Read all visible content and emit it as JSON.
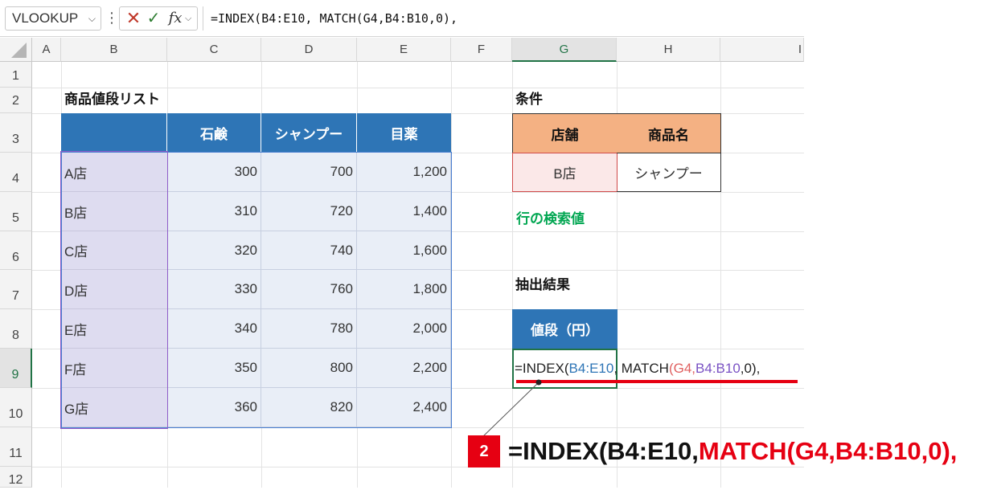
{
  "formula_bar": {
    "name_box": "VLOOKUP",
    "cancel_icon": "x-icon",
    "enter_icon": "check-icon",
    "fx_label": "fx",
    "formula": "=INDEX(B4:E10, MATCH(G4,B4:B10,0),"
  },
  "columns": [
    "A",
    "B",
    "C",
    "D",
    "E",
    "F",
    "G",
    "H",
    "I"
  ],
  "rows": [
    "1",
    "2",
    "3",
    "4",
    "5",
    "6",
    "7",
    "8",
    "9",
    "10",
    "11",
    "12"
  ],
  "price_list": {
    "title": "商品値段リスト",
    "headers": [
      "石鹸",
      "シャンプー",
      "目薬"
    ],
    "rows": [
      {
        "store": "A店",
        "values": [
          "300",
          "700",
          "1,200"
        ]
      },
      {
        "store": "B店",
        "values": [
          "310",
          "720",
          "1,400"
        ]
      },
      {
        "store": "C店",
        "values": [
          "320",
          "740",
          "1,600"
        ]
      },
      {
        "store": "D店",
        "values": [
          "330",
          "760",
          "1,800"
        ]
      },
      {
        "store": "E店",
        "values": [
          "340",
          "780",
          "2,000"
        ]
      },
      {
        "store": "F店",
        "values": [
          "350",
          "800",
          "2,200"
        ]
      },
      {
        "store": "G店",
        "values": [
          "360",
          "820",
          "2,400"
        ]
      }
    ]
  },
  "conditions": {
    "title": "条件",
    "header_store": "店舗",
    "header_product": "商品名",
    "store_value": "B店",
    "product_value": "シャンプー",
    "row_lookup_label": "行の検索値"
  },
  "result": {
    "title": "抽出結果",
    "header": "値段（円）",
    "formula_parts": {
      "p1": "=INDEX(",
      "range1": "B4:E10",
      "p2": ", MATCH",
      "paren": "(",
      "g4": "G4",
      "comma": ",",
      "range2": "B4:B10",
      "p3": ",0)",
      "end": ","
    }
  },
  "annotation": {
    "step": "2",
    "parts": {
      "a": "=INDEX(B4:E10,",
      "b": "MATCH(G4,B4:B10,0),"
    }
  },
  "colors": {
    "blue_header": "#2e75b6",
    "orange_header": "#f4b183",
    "store_col": "#dedcf0",
    "data_area": "#e9eef7",
    "green_label": "#00a651",
    "red": "#e60012",
    "ref_blue": "#2e75b6",
    "ref_purple": "#7a52c4",
    "ref_red": "#e06060"
  }
}
